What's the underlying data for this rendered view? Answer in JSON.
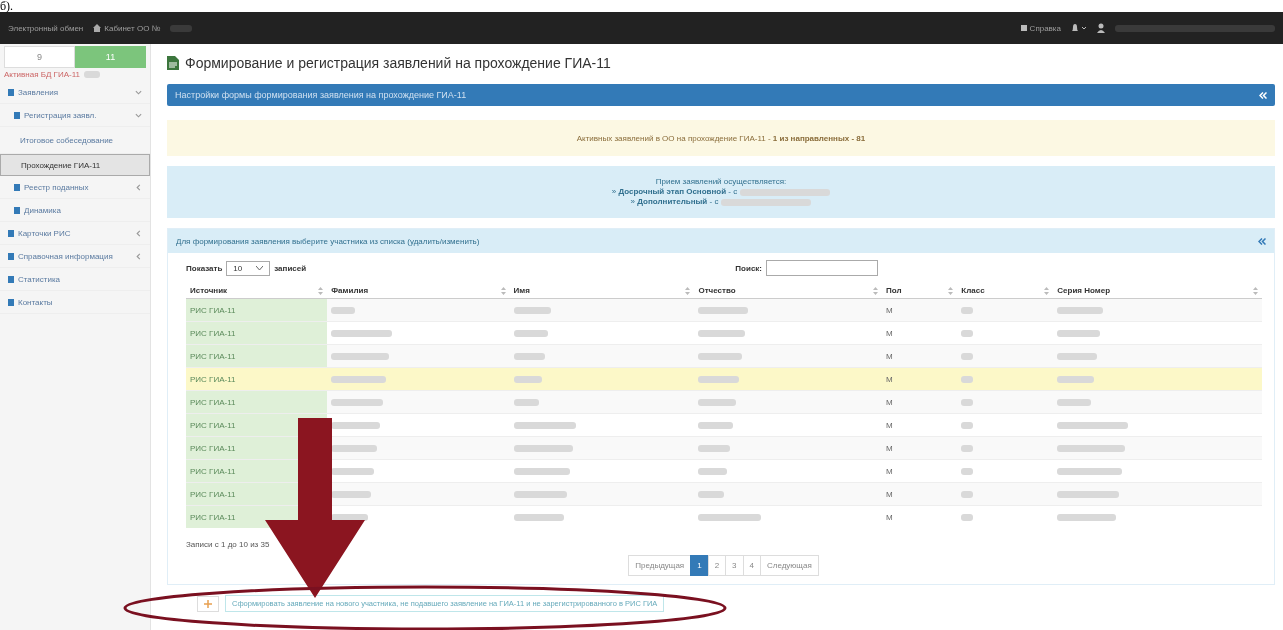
{
  "caption": "б).",
  "navbar": {
    "brand": "Электронный обмен",
    "cabinet": "Кабинет ОО №",
    "help": "Справка"
  },
  "sidebar": {
    "tabs": [
      {
        "label": "9",
        "selected": false
      },
      {
        "label": "11",
        "selected": true
      }
    ],
    "db_label": "Активная БД ГИА-11",
    "items": [
      {
        "label": "Заявления",
        "expanded": true,
        "selected": false,
        "children": [
          {
            "label": "Регистрация заявл.",
            "expanded": true,
            "selected": false,
            "children": [
              {
                "label": "Итоговое собеседование",
                "selected": false
              },
              {
                "label": "Прохождение ГИА-11",
                "selected": true
              }
            ]
          },
          {
            "label": "Реестр поданных",
            "expanded": false,
            "selected": false
          },
          {
            "label": "Динамика",
            "selected": false
          }
        ]
      },
      {
        "label": "Карточки РИС",
        "expanded": false,
        "selected": false
      },
      {
        "label": "Справочная информация",
        "expanded": false,
        "selected": false
      },
      {
        "label": "Статистика",
        "selected": false
      },
      {
        "label": "Контакты",
        "selected": false
      }
    ]
  },
  "page_title": "Формирование и регистрация заявлений на прохождение ГИА-11",
  "settings_panel": {
    "title": "Настройки формы формирования заявления на прохождение ГИА-11"
  },
  "alert": {
    "text": "Активных заявлений в ОО на прохождение ГИА-11 - **1 из направленных - 81**"
  },
  "info": {
    "heading": "Прием заявлений осуществляется:",
    "lines": [
      "» **Досрочный этап Основной** - с",
      "» **Дополнительный** - с"
    ]
  },
  "list_panel": {
    "title": "Для формирования заявления выберите участника из списка (удалить/изменить)",
    "show_label": "Показать",
    "page_size": "10",
    "entries_label": "записей",
    "search_label": "Поиск:",
    "columns": [
      "Источник",
      "Фамилия",
      "Имя",
      "Отчество",
      "Пол",
      "Класс",
      "Серия Номер"
    ],
    "rows": [
      {
        "source": "РИС ГИА-11",
        "gender": "М",
        "selected": false
      },
      {
        "source": "РИС ГИА-11",
        "gender": "М",
        "selected": false
      },
      {
        "source": "РИС ГИА-11",
        "gender": "М",
        "selected": false
      },
      {
        "source": "РИС ГИА-11",
        "gender": "М",
        "selected": true
      },
      {
        "source": "РИС ГИА-11",
        "gender": "М",
        "selected": false
      },
      {
        "source": "РИС ГИА-11",
        "gender": "М",
        "selected": false
      },
      {
        "source": "РИС ГИА-11",
        "gender": "М",
        "selected": false
      },
      {
        "source": "РИС ГИА-11",
        "gender": "М",
        "selected": false
      },
      {
        "source": "РИС ГИА-11",
        "gender": "М",
        "selected": false
      },
      {
        "source": "РИС ГИА-11",
        "gender": "М",
        "selected": false
      }
    ],
    "summary": "Записи с 1 до 10 из 35",
    "pagination": [
      {
        "label": "Предыдущая",
        "selected": false
      },
      {
        "label": "1",
        "selected": true
      },
      {
        "label": "2",
        "selected": false
      },
      {
        "label": "3",
        "selected": false
      },
      {
        "label": "4",
        "selected": false
      },
      {
        "label": "Следующая",
        "selected": false
      }
    ]
  },
  "new_participant": {
    "text": "Сформировать заявление на нового участника, не подавшего заявление на ГИА-11 и не зарегистрированного в РИС ГИА"
  }
}
